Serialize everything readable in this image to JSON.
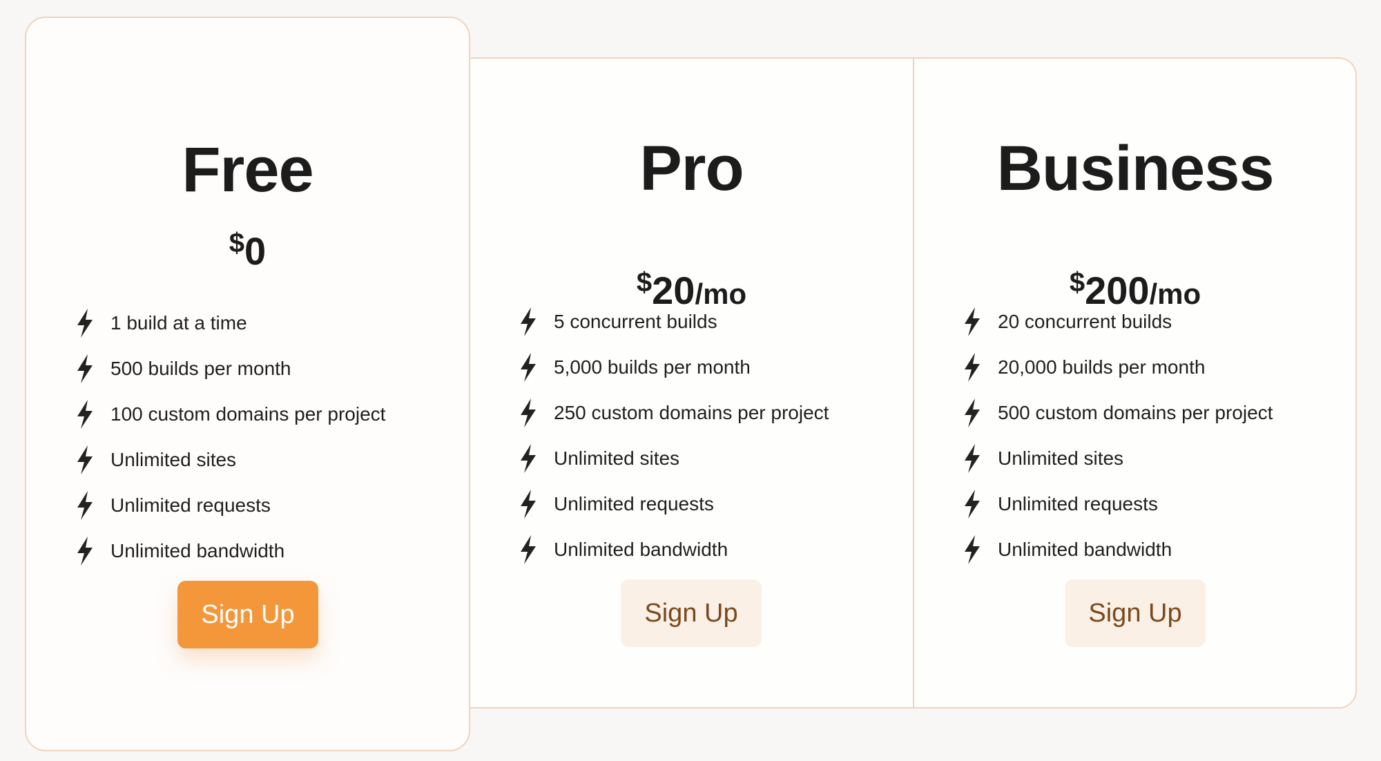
{
  "theme": {
    "accent": "#f4973a",
    "border": "#f0d3bd",
    "secondary_button_bg": "#fbf0e6",
    "secondary_button_text": "#7a4a1c"
  },
  "plans": [
    {
      "name": "Free",
      "currency": "$",
      "amount": "0",
      "period": "",
      "feature_icon": "lightning-bolt-icon",
      "features": [
        "1 build at a time",
        "500 builds per month",
        "100 custom domains per project",
        "Unlimited sites",
        "Unlimited requests",
        "Unlimited bandwidth"
      ],
      "cta": "Sign Up",
      "highlighted": true
    },
    {
      "name": "Pro",
      "currency": "$",
      "amount": "20",
      "period": "/mo",
      "feature_icon": "lightning-bolt-icon",
      "features": [
        "5 concurrent builds",
        "5,000 builds per month",
        "250 custom domains per project",
        "Unlimited sites",
        "Unlimited requests",
        "Unlimited bandwidth"
      ],
      "cta": "Sign Up",
      "highlighted": false
    },
    {
      "name": "Business",
      "currency": "$",
      "amount": "200",
      "period": "/mo",
      "feature_icon": "lightning-bolt-icon",
      "features": [
        "20 concurrent builds",
        "20,000 builds per month",
        "500 custom domains per project",
        "Unlimited sites",
        "Unlimited requests",
        "Unlimited bandwidth"
      ],
      "cta": "Sign Up",
      "highlighted": false
    }
  ]
}
